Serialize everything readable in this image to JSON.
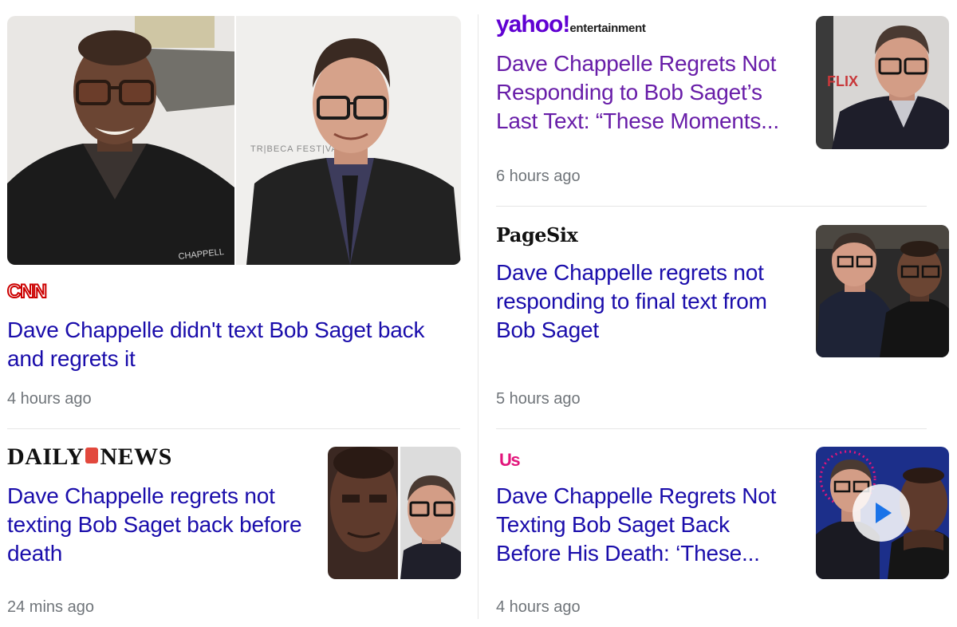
{
  "articles": [
    {
      "source": "CNN",
      "headline": "Dave Chappelle didn't text Bob Saget back and regrets it",
      "time": "4 hours ago",
      "image_text": "TR|BECA FEST|VAL",
      "jacket_text": "CHAPPELL"
    },
    {
      "source_main": "yahoo!",
      "source_sub": "entertainment",
      "headline": "Dave Chappelle Regrets Not Responding to Bob Saget’s Last Text: “These Moments...",
      "time": "6 hours ago",
      "image_text": "FLIX"
    },
    {
      "source": "PageSix",
      "headline": "Dave Chappelle regrets not responding to final text from Bob Saget",
      "time": "5 hours ago"
    },
    {
      "source_left": "DAILY",
      "source_right": "NEWS",
      "headline": "Dave Chappelle regrets not texting Bob Saget back before death",
      "time": "24 mins ago"
    },
    {
      "source": "Us",
      "headline": "Dave Chappelle Regrets Not Texting Bob Saget Back Before His Death: ‘These...",
      "time": "4 hours ago"
    }
  ],
  "colors": {
    "link": "#1a0dab",
    "visited": "#681da8",
    "meta": "#70757a",
    "cnn": "#cc0000",
    "yahoo": "#6001d2",
    "us": "#e2157b",
    "play": "#1a73e8"
  }
}
